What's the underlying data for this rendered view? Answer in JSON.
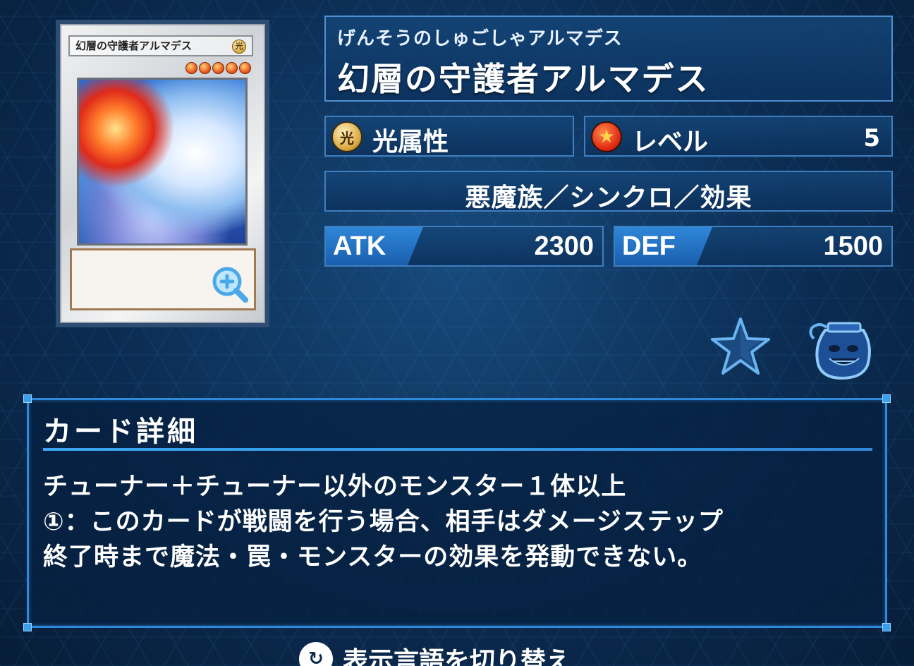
{
  "card": {
    "image_name": "幻層の守護者アルマデス",
    "attribute_glyph": "光",
    "level_stars": 5
  },
  "header": {
    "ruby": "げんそうのしゅごしゃアルマデス",
    "name": "幻層の守護者アルマデス"
  },
  "attribute": {
    "icon_glyph": "光",
    "label": "光属性"
  },
  "level": {
    "icon_glyph": "★",
    "label": "レベル",
    "value": "5"
  },
  "type_line": "悪魔族／シンクロ／効果",
  "stats": {
    "atk_label": "ATK",
    "atk_value": "2300",
    "def_label": "DEF",
    "def_value": "1500"
  },
  "icons": {
    "favorite": "star-icon",
    "pot": "pot-of-greed-icon",
    "zoom": "zoom-in-icon"
  },
  "details": {
    "title": "カード詳細",
    "lines": [
      "チューナー＋チューナー以外のモンスター１体以上",
      "①：このカードが戦闘を行う場合、相手はダメージステップ",
      "終了時まで魔法・罠・モンスターの効果を発動できない。"
    ]
  },
  "footer": {
    "button_glyph": "↻",
    "toggle_language_label": "表示言語を切り替え"
  },
  "colors": {
    "accent": "#2f88d8",
    "background": "#0b2c52"
  }
}
